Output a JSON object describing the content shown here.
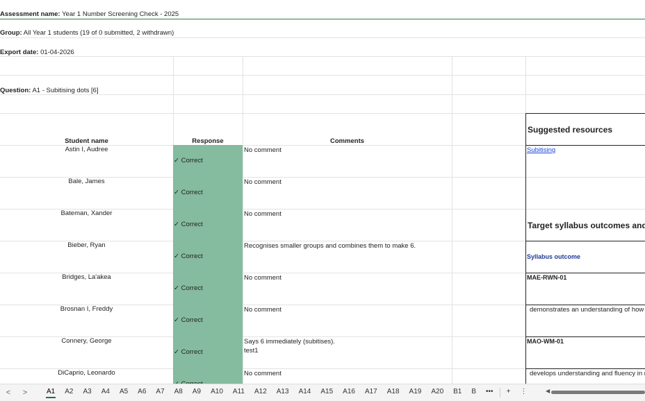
{
  "meta": {
    "assessment_label": "Assessment name:",
    "assessment_value": "Year 1 Number Screening Check - 2025",
    "group_label": "Group:",
    "group_value": "All Year 1 students (19 of 0 submitted, 2 withdrawn)",
    "export_label": "Export date:",
    "export_value": "01-04-2026",
    "question_label": "Question:",
    "question_value": "A1 - Subitising dots [6]"
  },
  "headers": {
    "student_name": "Student name",
    "response": "Response",
    "comments": "Comments"
  },
  "rows": [
    {
      "name": "Astin I, Audree",
      "response": "✓ Correct",
      "comment": [
        "No comment"
      ]
    },
    {
      "name": "Bale, James",
      "response": "✓ Correct",
      "comment": [
        "No comment"
      ]
    },
    {
      "name": "Bateman, Xander",
      "response": "✓ Correct",
      "comment": [
        "No comment"
      ]
    },
    {
      "name": "Bieber, Ryan",
      "response": "✓ Correct",
      "comment": [
        "Recognises smaller groups and combines them to make 6."
      ]
    },
    {
      "name": "Bridges, La'akea",
      "response": "✓ Correct",
      "comment": [
        "No comment"
      ]
    },
    {
      "name": "Brosnan I, Freddy",
      "response": "✓ Correct",
      "comment": [
        "No comment"
      ]
    },
    {
      "name": "Connery, George",
      "response": "✓ Correct",
      "comment": [
        "Says 6 immediately (subitises).",
        "test1"
      ]
    },
    {
      "name": "DiCaprio, Leonardo",
      "response": "✓ Correct",
      "comment": [
        "No comment"
      ]
    }
  ],
  "side_panel": {
    "suggested_resources": "Suggested resources",
    "resource_link": "Subitising",
    "target_outcomes": "Target syllabus outcomes and c",
    "syllabus_outcome_label": "Syllabus outcome",
    "outcome_code_1": "MAE-RWN-01",
    "outcome_desc_1": "demonstrates an understanding of how",
    "outcome_code_2": "MAO-WM-01",
    "outcome_desc_2": "develops understanding and fluency in r"
  },
  "tabs": [
    "A1",
    "A2",
    "A3",
    "A4",
    "A5",
    "A6",
    "A7",
    "A8",
    "A9",
    "A10",
    "A11",
    "A12",
    "A13",
    "A14",
    "A15",
    "A16",
    "A17",
    "A18",
    "A19",
    "A20",
    "B1",
    "B"
  ],
  "tab_active": "A1",
  "tab_controls": {
    "prev": "<",
    "next": ">",
    "more": "•••",
    "add": "+",
    "menu": "⋮"
  },
  "colors": {
    "response_fill": "#85bb9f",
    "link": "#1a45d8",
    "outcome_label": "#1f3a93",
    "active_tab": "#1e7145"
  }
}
